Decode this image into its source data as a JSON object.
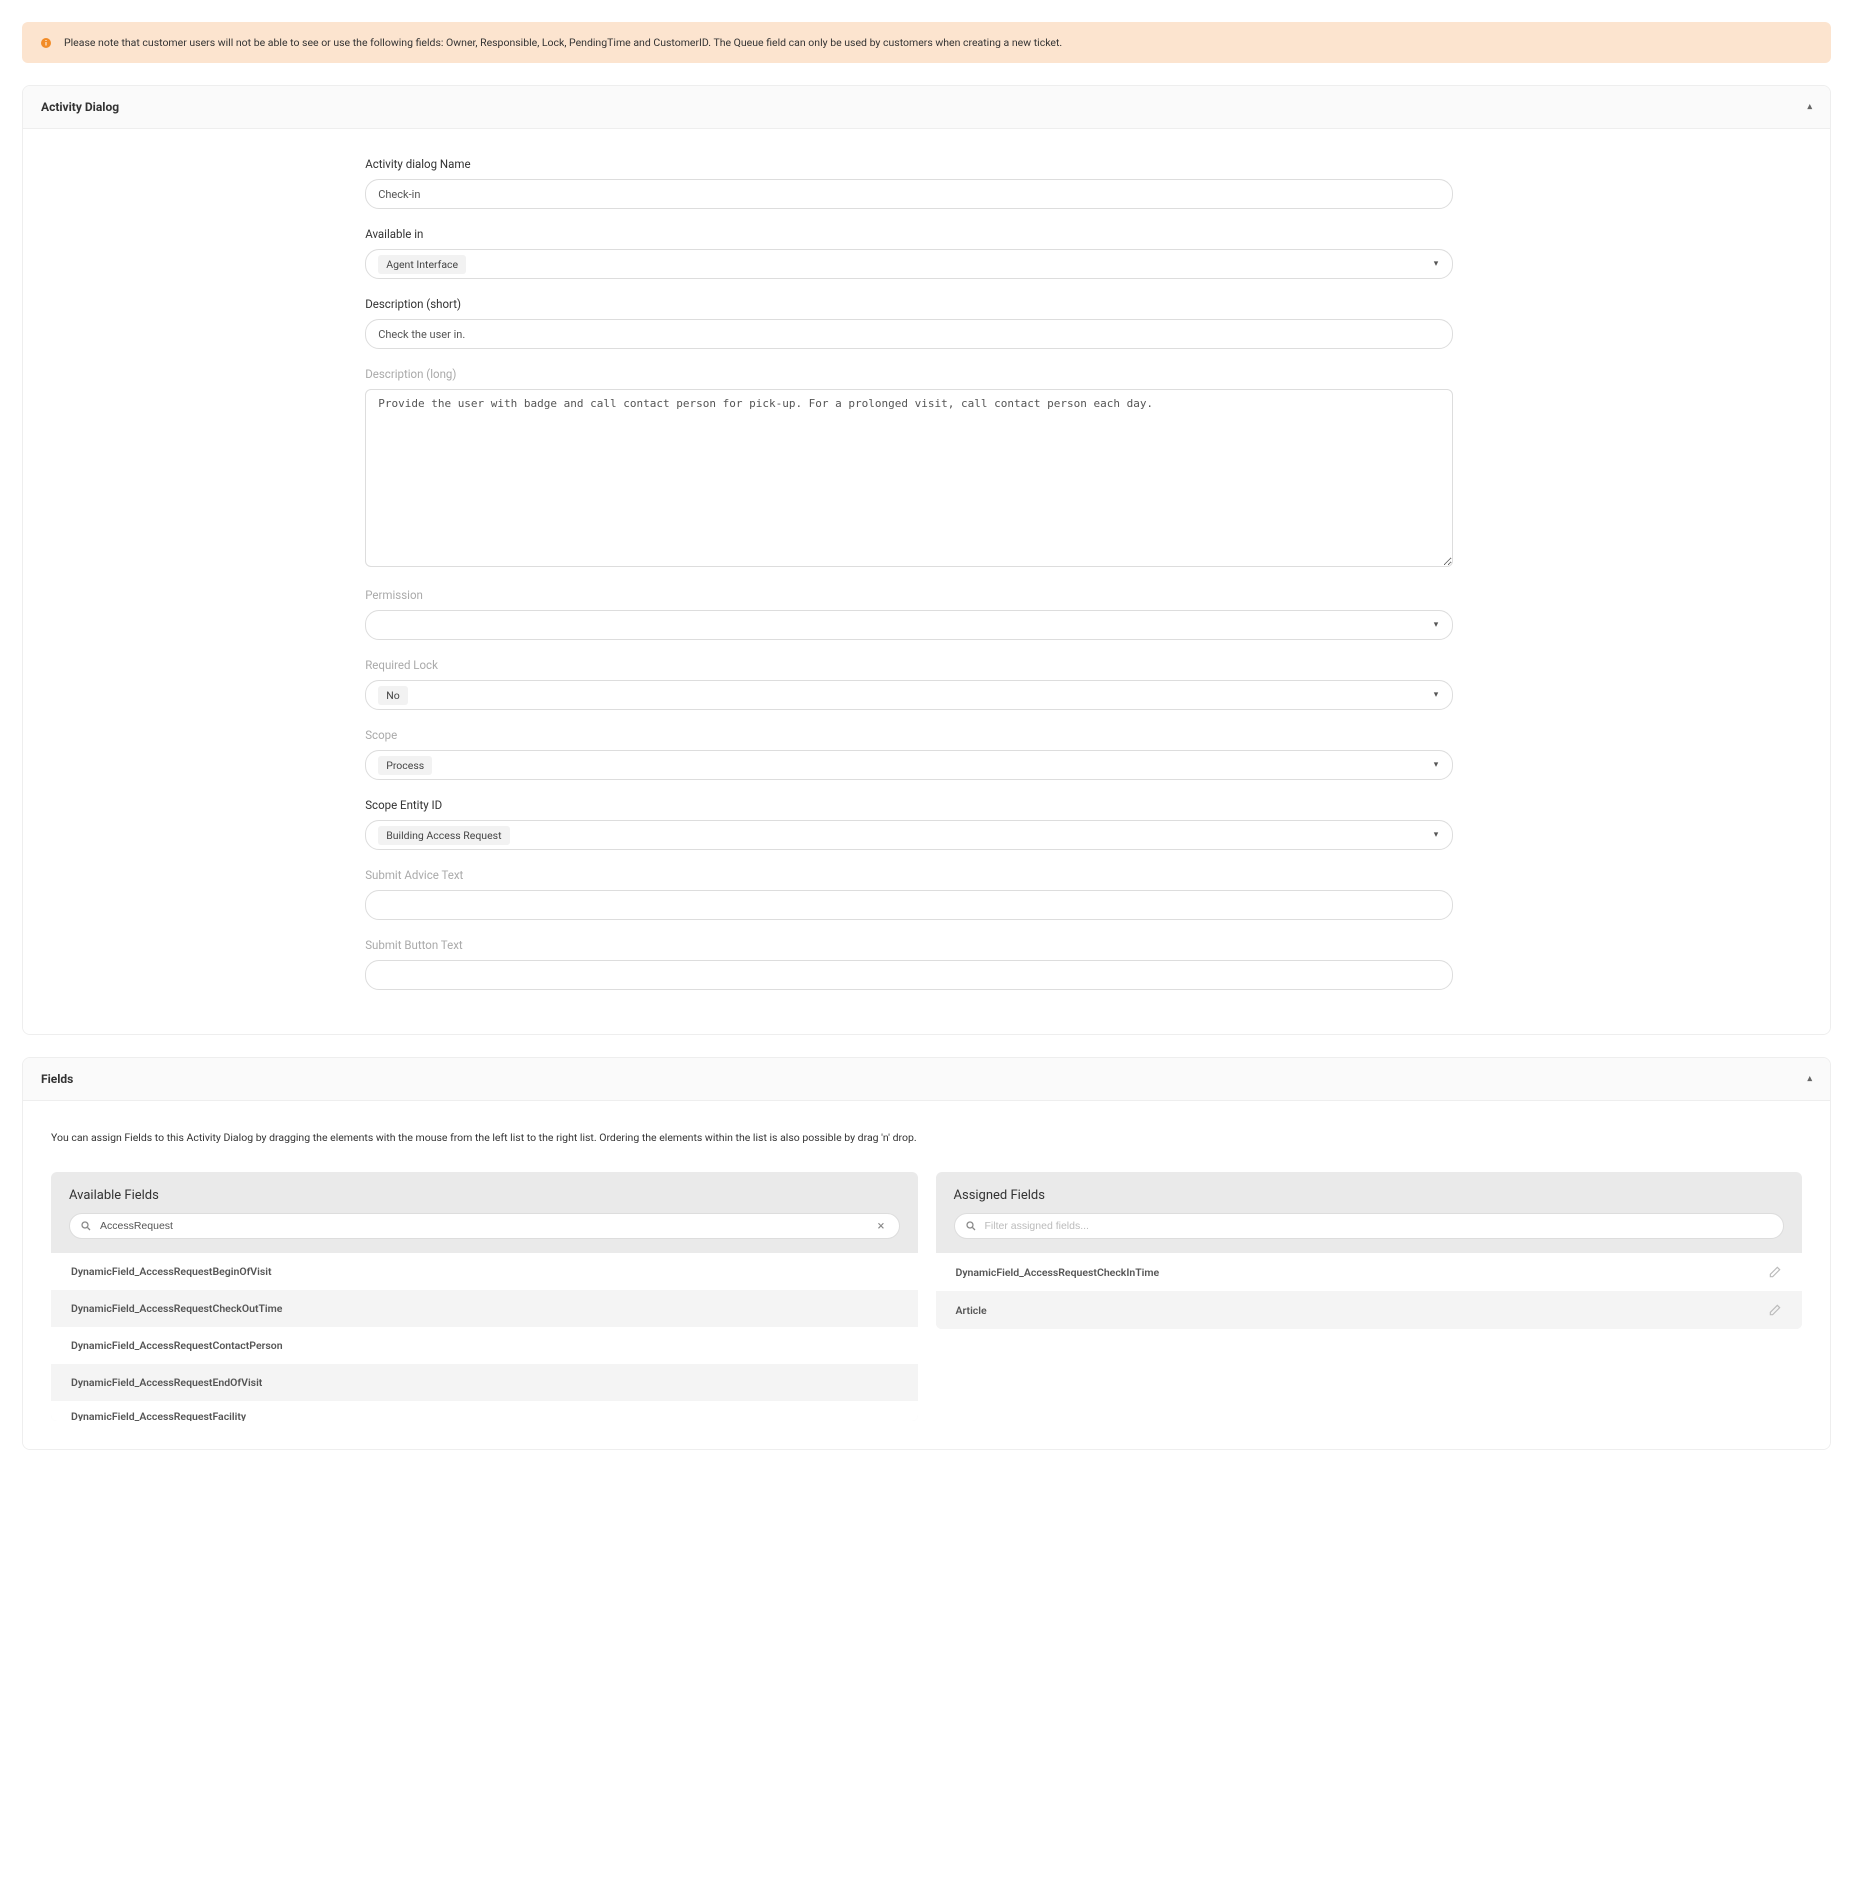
{
  "alert": {
    "text": "Please note that customer users will not be able to see or use the following fields: Owner, Responsible, Lock, PendingTime and CustomerID. The Queue field can only be used by customers when creating a new ticket."
  },
  "activity_dialog": {
    "header": "Activity Dialog",
    "name_label": "Activity dialog Name",
    "name_value": "Check-in",
    "available_in_label": "Available in",
    "available_in_value": "Agent Interface",
    "desc_short_label": "Description (short)",
    "desc_short_value": "Check the user in.",
    "desc_long_label": "Description (long)",
    "desc_long_value": "Provide the user with badge and call contact person for pick-up. For a prolonged visit, call contact person each day.",
    "permission_label": "Permission",
    "permission_value": "",
    "required_lock_label": "Required Lock",
    "required_lock_value": "No",
    "scope_label": "Scope",
    "scope_value": "Process",
    "scope_entity_id_label": "Scope Entity ID",
    "scope_entity_id_value": "Building Access Request",
    "submit_advice_label": "Submit Advice Text",
    "submit_advice_value": "",
    "submit_button_label": "Submit Button Text",
    "submit_button_value": ""
  },
  "fields": {
    "header": "Fields",
    "instruction": "You can assign Fields to this Activity Dialog by dragging the elements with the mouse from the left list to the right list. Ordering the elements within the list is also possible by drag 'n' drop.",
    "available_title": "Available Fields",
    "assigned_title": "Assigned Fields",
    "available_filter_value": "AccessRequest",
    "assigned_filter_placeholder": "Filter assigned fields...",
    "available_items": [
      "DynamicField_AccessRequestBeginOfVisit",
      "DynamicField_AccessRequestCheckOutTime",
      "DynamicField_AccessRequestContactPerson",
      "DynamicField_AccessRequestEndOfVisit",
      "DynamicField_AccessRequestFacility"
    ],
    "assigned_items": [
      "DynamicField_AccessRequestCheckInTime",
      "Article"
    ]
  }
}
